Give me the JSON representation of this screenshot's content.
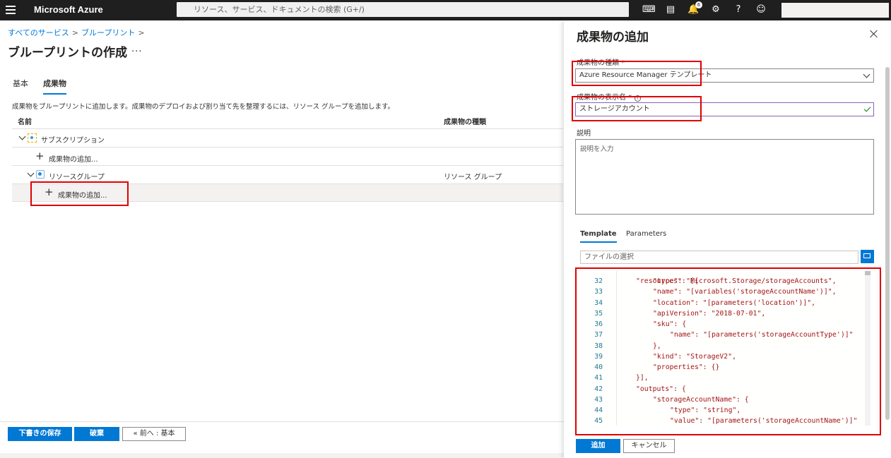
{
  "topbar": {
    "brand": "Microsoft Azure",
    "search_placeholder": "リソース、サービス、ドキュメントの検索 (G+/)",
    "notification_count": "6",
    "icons": [
      "cloud-shell-icon",
      "directory-filter-icon",
      "notifications-icon",
      "settings-icon",
      "help-icon",
      "feedback-icon"
    ]
  },
  "breadcrumb": {
    "items": [
      "すべてのサービス",
      "ブループリント"
    ],
    "separator": ">"
  },
  "page": {
    "title": "ブループリントの作成",
    "more": "...",
    "tabs": [
      {
        "label": "基本",
        "active": false
      },
      {
        "label": "成果物",
        "active": true
      }
    ],
    "description": "成果物をブループリントに追加します。成果物のデプロイおよび割り当て先を整理するには、リソース グループを追加します。"
  },
  "table": {
    "headers": {
      "name": "名前",
      "type": "成果物の種類"
    },
    "rows": [
      {
        "name": "サブスクリプション",
        "type": ""
      },
      {
        "name": "成果物の追加...",
        "type": ""
      },
      {
        "name": "リソースグループ",
        "type": "リソース グループ"
      },
      {
        "name": "成果物の追加...",
        "type": ""
      }
    ]
  },
  "footer": {
    "save_draft": "下書きの保存",
    "discard": "破棄",
    "previous": "« 前へ : 基本"
  },
  "panel": {
    "title": "成果物の追加",
    "artifact_type_label": "成果物の種類",
    "artifact_type_value": "Azure Resource Manager テンプレート",
    "display_name_label": "成果物の表示名",
    "display_name_value": "ストレージアカウント",
    "required_mark": "*",
    "info": "i",
    "description_label": "説明",
    "description_placeholder": "説明を入力",
    "tabs": [
      {
        "label": "Template",
        "active": true
      },
      {
        "label": "Parameters",
        "active": false
      }
    ],
    "file_placeholder": "ファイルの選択",
    "add_button": "追加",
    "cancel_button": "キャンセル"
  },
  "editor": {
    "top_partial": "\"resources\": [{",
    "lines": [
      {
        "n": "32",
        "text": "\"type\": \"Microsoft.Storage/storageAccounts\","
      },
      {
        "n": "33",
        "text": "\"name\": \"[variables('storageAccountName')]\","
      },
      {
        "n": "34",
        "text": "\"location\": \"[parameters('location')]\","
      },
      {
        "n": "35",
        "text": "\"apiVersion\": \"2018-07-01\","
      },
      {
        "n": "36",
        "text": "\"sku\": {"
      },
      {
        "n": "37",
        "text": "\"name\": \"[parameters('storageAccountType')]\""
      },
      {
        "n": "38",
        "text": "},"
      },
      {
        "n": "39",
        "text": "\"kind\": \"StorageV2\","
      },
      {
        "n": "40",
        "text": "\"properties\": {}"
      },
      {
        "n": "41",
        "text": "}],"
      },
      {
        "n": "42",
        "text": "\"outputs\": {"
      },
      {
        "n": "43",
        "text": "\"storageAccountName\": {"
      },
      {
        "n": "44",
        "text": "\"type\": \"string\","
      },
      {
        "n": "45",
        "text": "\"value\": \"[parameters('storageAccountName')]\""
      }
    ]
  }
}
